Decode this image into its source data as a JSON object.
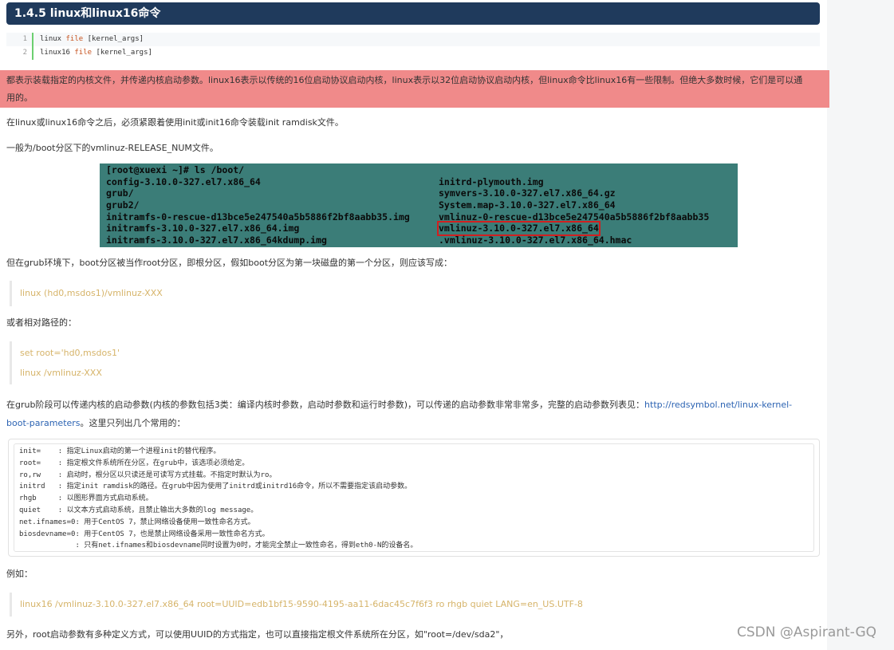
{
  "heading": "1.4.5 linux和linux16命令",
  "code1": [
    {
      "ln": "1",
      "cmd": "linux",
      "kw": "file",
      "arg": "[kernel_args]"
    },
    {
      "ln": "2",
      "cmd": "linux16",
      "kw": "file",
      "arg": "[kernel_args]"
    }
  ],
  "highlight": {
    "line1": "都表示装载指定的内核文件，并传递内核启动参数。linux16表示以传统的16位启动协议启动内核，linux表示以32位启动协议启动内核，但linux命令比linux16有一些限制。但绝大多数时候，它们是可以通",
    "line2": "用的。"
  },
  "para_after_linux16": "在linux或linux16命令之后，必须紧跟着使用init或init16命令装载init ramdisk文件。",
  "para_boot": "一般为/boot分区下的vmlinuz-RELEASE_NUM文件。",
  "terminal": {
    "prompt": "[root@xuexi ~]# ls /boot/",
    "rows": [
      [
        "config-3.10.0-327.el7.x86_64",
        "initrd-plymouth.img"
      ],
      [
        "grub/",
        "symvers-3.10.0-327.el7.x86_64.gz"
      ],
      [
        "grub2/",
        "System.map-3.10.0-327.el7.x86_64"
      ],
      [
        "initramfs-0-rescue-d13bce5e247540a5b5886f2bf8aabb35.img",
        "vmlinuz-0-rescue-d13bce5e247540a5b5886f2bf8aabb35"
      ],
      [
        "initramfs-3.10.0-327.el7.x86_64.img",
        "vmlinuz-3.10.0-327.el7.x86_64"
      ],
      [
        "initramfs-3.10.0-327.el7.x86_64kdump.img",
        ".vmlinuz-3.10.0-327.el7.x86_64.hmac"
      ]
    ]
  },
  "para_grub": "但在grub环境下，boot分区被当作root分区，即根分区，假如boot分区为第一块磁盘的第一个分区，则应该写成：",
  "quote1": "linux (hd0,msdos1)/vmlinuz-XXX",
  "para_relative": "或者相对路径的：",
  "quote2": [
    "set root='hd0,msdos1'",
    "linux /vmlinuz-XXX"
  ],
  "para_params": {
    "line1": "在grub阶段可以传递内核的启动参数(内核的参数包括3类：编译内核时参数，启动时参数和运行时参数)，可以传递的启动参数非常非常多，完整的启动参数列表见：",
    "link1": "http://redsymbol.net/linux-kernel-",
    "link2": "boot-parameters",
    "line2": "。这里只列出几个常用的："
  },
  "params": [
    "init=    : 指定Linux启动的第一个进程init的替代程序。",
    "root=    : 指定根文件系统所在分区，在grub中，该选项必须给定。",
    "ro,rw    : 启动时，根分区以只读还是可读写方式挂载。不指定时默认为ro。",
    "initrd   : 指定init ramdisk的路径。在grub中因为使用了initrd或initrd16命令，所以不需要指定该启动参数。",
    "rhgb     : 以图形界面方式启动系统。",
    "quiet    : 以文本方式启动系统，且禁止输出大多数的log message。",
    "net.ifnames=0: 用于CentOS 7，禁止网络设备使用一致性命名方式。",
    "biosdevname=0: 用于CentOS 7，也是禁止网络设备采用一致性命名方式。",
    "             : 只有net.ifnames和biosdevname同时设置为0时，才能完全禁止一致性命名，得到eth0-N的设备名。"
  ],
  "para_example": "例如：",
  "quote3": "linux16 /vmlinuz-3.10.0-327.el7.x86_64 root=UUID=edb1bf15-9590-4195-aa11-6dac45c7f6f3 ro rhgb quiet LANG=en_US.UTF-8",
  "para_last": "另外，root启动参数有多种定义方式，可以使用UUID的方式指定，也可以直接指定根文件系统所在分区，如\"root=/dev/sda2\"，",
  "watermark": "CSDN @Aspirant-GQ"
}
